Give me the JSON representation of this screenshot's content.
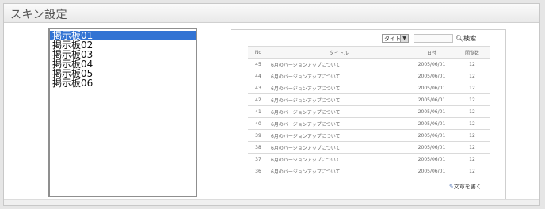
{
  "panel": {
    "title": "スキン設定"
  },
  "boards": [
    {
      "label": "掲示板01",
      "selected": true
    },
    {
      "label": "掲示板02",
      "selected": false
    },
    {
      "label": "掲示板03",
      "selected": false
    },
    {
      "label": "掲示板04",
      "selected": false
    },
    {
      "label": "掲示板05",
      "selected": false
    },
    {
      "label": "掲示板06",
      "selected": false
    }
  ],
  "preview": {
    "search_select_value": "タイトル",
    "search_button_label": "検索",
    "search_icon": "magnifier-icon",
    "table_headers": {
      "no": "No",
      "title": "タイトル",
      "date": "日付",
      "views": "閲覧数"
    },
    "rows": [
      {
        "no": "45",
        "title": "6月のバージョンアップについて",
        "date": "2005/06/01",
        "views": "12"
      },
      {
        "no": "44",
        "title": "6月のバージョンアップについて",
        "date": "2005/06/01",
        "views": "12"
      },
      {
        "no": "43",
        "title": "6月のバージョンアップについて",
        "date": "2005/06/01",
        "views": "12"
      },
      {
        "no": "42",
        "title": "6月のバージョンアップについて",
        "date": "2005/06/01",
        "views": "12"
      },
      {
        "no": "41",
        "title": "6月のバージョンアップについて",
        "date": "2005/06/01",
        "views": "12"
      },
      {
        "no": "40",
        "title": "6月のバージョンアップについて",
        "date": "2005/06/01",
        "views": "12"
      },
      {
        "no": "39",
        "title": "6月のバージョンアップについて",
        "date": "2005/06/01",
        "views": "12"
      },
      {
        "no": "38",
        "title": "6月のバージョンアップについて",
        "date": "2005/06/01",
        "views": "12"
      },
      {
        "no": "37",
        "title": "6月のバージョンアップについて",
        "date": "2005/06/01",
        "views": "12"
      },
      {
        "no": "36",
        "title": "6月のバージョンアップについて",
        "date": "2005/06/01",
        "views": "12"
      }
    ],
    "write_button_label": "文章を書く",
    "write_icon": "pencil-icon"
  },
  "colors": {
    "selection": "#3273d3",
    "panel_bg": "#ffffff",
    "page_bg": "#e6e6e6"
  }
}
